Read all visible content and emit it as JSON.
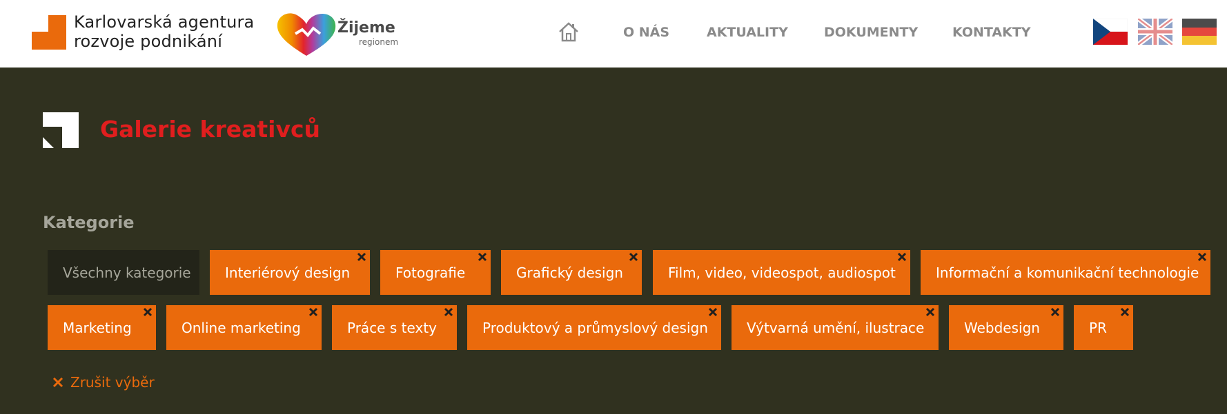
{
  "brand": {
    "line1": "Karlovarská agentura",
    "line2": "rozvoje podnikání",
    "partner_name": "Žijeme",
    "partner_sub": "regionem",
    "accent_color": "#ea6a0c"
  },
  "nav": {
    "home_icon": "home-icon",
    "items": [
      {
        "label": "O NÁS"
      },
      {
        "label": "AKTUALITY"
      },
      {
        "label": "DOKUMENTY"
      },
      {
        "label": "KONTAKTY"
      }
    ]
  },
  "languages": [
    {
      "icon": "czech-flag-icon"
    },
    {
      "icon": "uk-flag-icon"
    },
    {
      "icon": "german-flag-icon"
    }
  ],
  "page": {
    "title": "Galerie kreativců",
    "title_color": "#e01e1e"
  },
  "categories": {
    "heading": "Kategorie",
    "all_label": "Všechny kategorie",
    "items": [
      {
        "label": "Interiérový design"
      },
      {
        "label": "Fotografie"
      },
      {
        "label": "Grafický design"
      },
      {
        "label": "Film, video, videospot, audiospot"
      },
      {
        "label": "Informační a komunikační technologie"
      },
      {
        "label": "Marketing"
      },
      {
        "label": "Online marketing"
      },
      {
        "label": "Práce s texty"
      },
      {
        "label": "Produktový a průmyslový design"
      },
      {
        "label": "Výtvarná umění, ilustrace"
      },
      {
        "label": "Webdesign"
      },
      {
        "label": "PR"
      }
    ],
    "reset_label": "Zrušit výběr"
  }
}
